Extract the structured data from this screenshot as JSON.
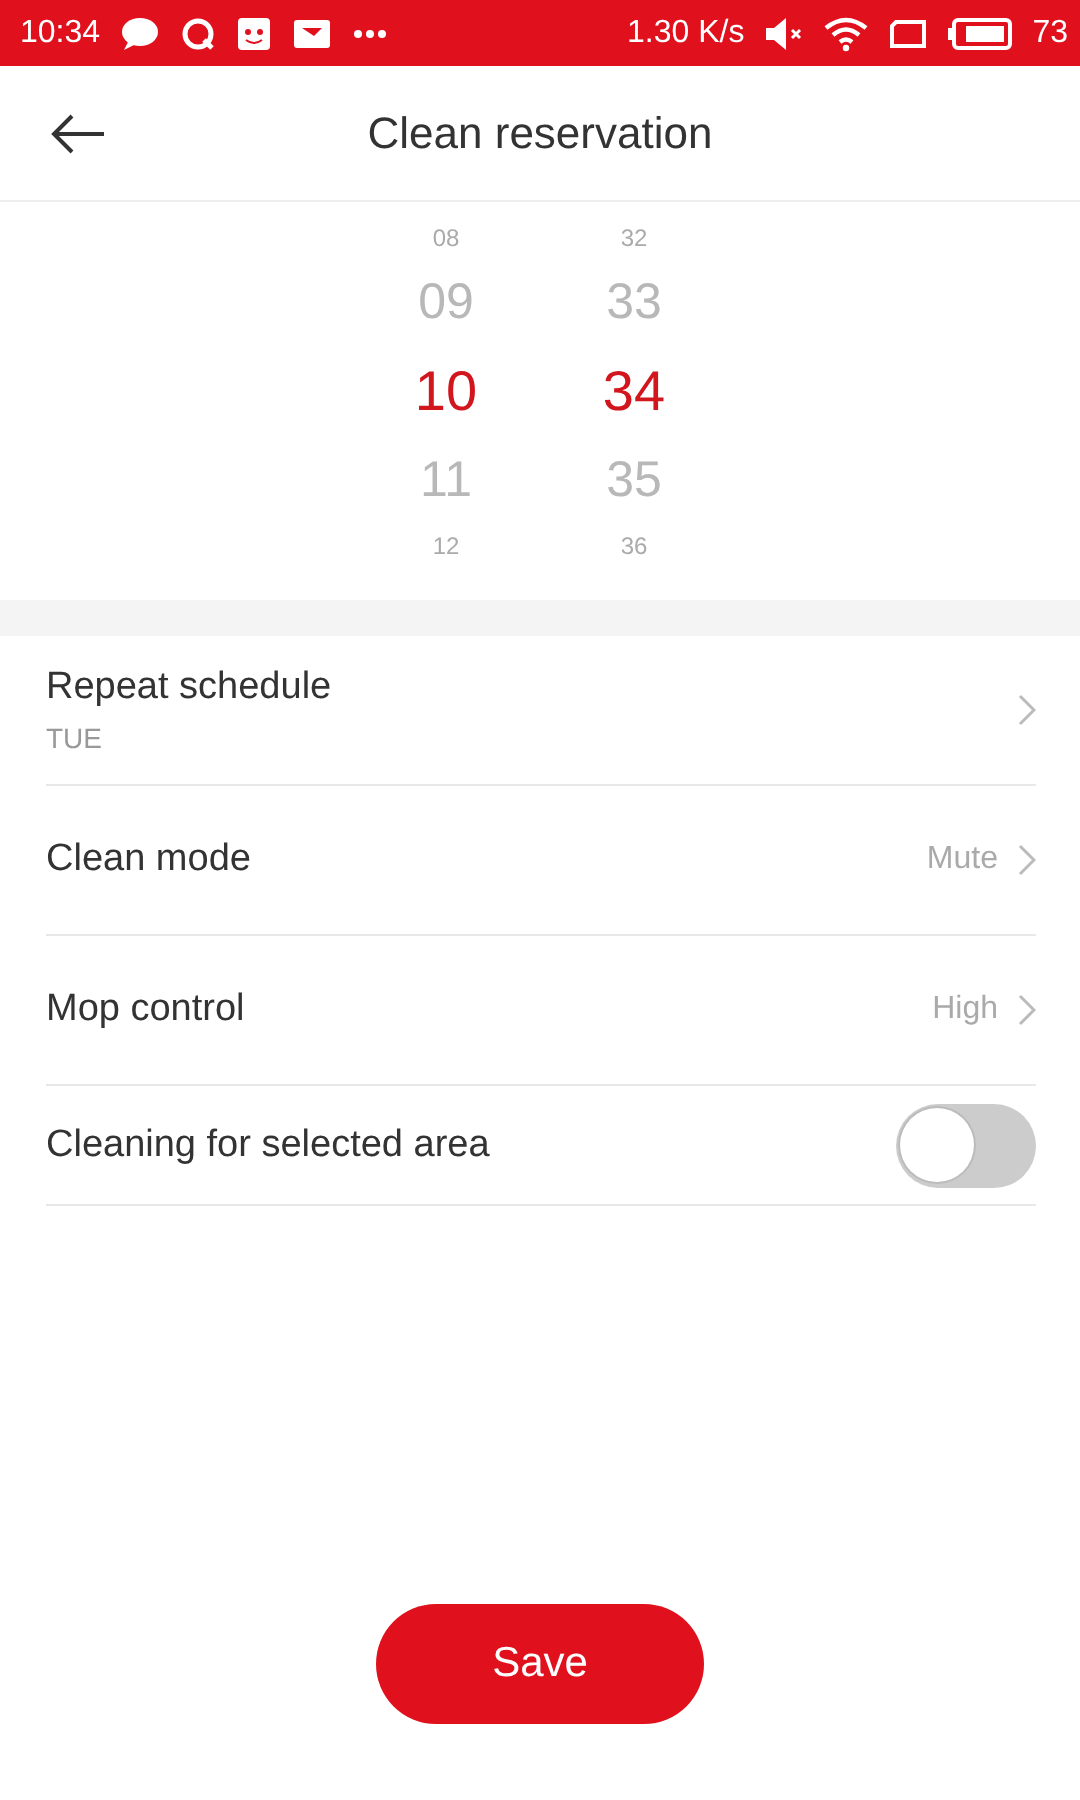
{
  "status_bar": {
    "time": "10:34",
    "speed": "1.30 K/s",
    "battery": "73"
  },
  "header": {
    "title": "Clean reservation"
  },
  "time_picker": {
    "columns": [
      {
        "items": [
          {
            "label": "08",
            "selected": false
          },
          {
            "label": "09",
            "selected": false
          },
          {
            "label": "10",
            "selected": true
          },
          {
            "label": "11",
            "selected": false
          },
          {
            "label": "12",
            "selected": false
          }
        ]
      },
      {
        "items": [
          {
            "label": "32",
            "selected": false
          },
          {
            "label": "33",
            "selected": false
          },
          {
            "label": "34",
            "selected": true
          },
          {
            "label": "35",
            "selected": false
          },
          {
            "label": "36",
            "selected": false
          }
        ]
      }
    ]
  },
  "settings": [
    {
      "kind": "link",
      "label": "Repeat schedule",
      "subtitle": "TUE"
    },
    {
      "kind": "link",
      "label": "Clean mode",
      "value": "Mute"
    },
    {
      "kind": "link",
      "label": "Mop control",
      "value": "High"
    },
    {
      "kind": "toggle",
      "label": "Cleaning for selected area",
      "on": false
    }
  ],
  "save_button": {
    "label": "Save"
  }
}
